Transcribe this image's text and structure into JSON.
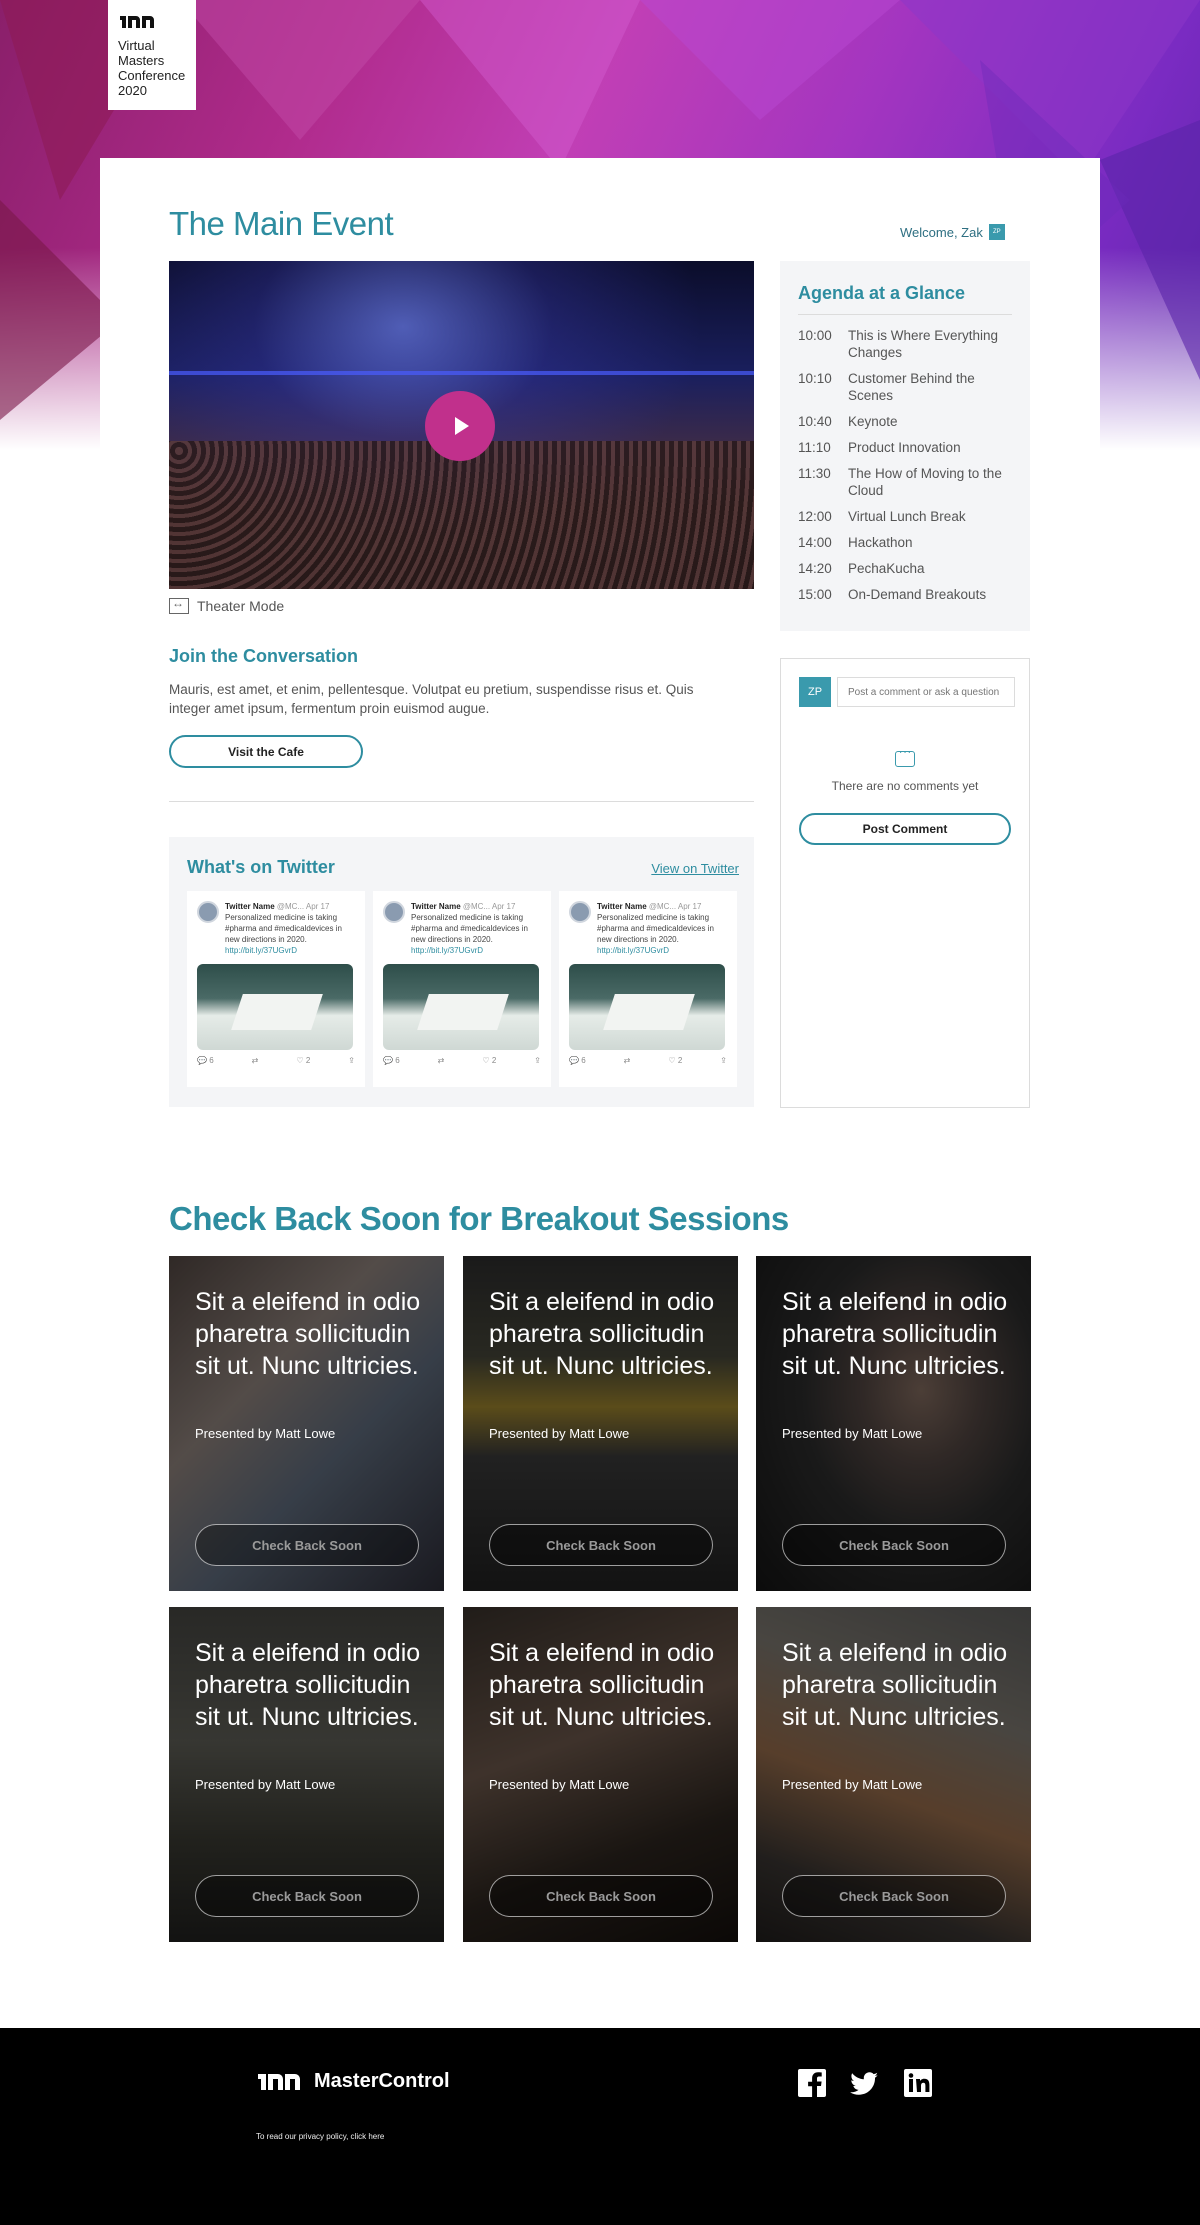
{
  "brand": {
    "logo_lines": [
      "Virtual",
      "Masters",
      "Conference",
      "2020"
    ]
  },
  "header": {
    "title": "The Main Event",
    "welcome": "Welcome, Zak",
    "welcome_badge": "ZP"
  },
  "video": {
    "theater_mode": "Theater Mode"
  },
  "conversation": {
    "title": "Join the Conversation",
    "text": "Mauris, est amet, et enim, pellentesque. Volutpat eu pretium, suspendisse risus et. Quis integer amet ipsum, fermentum proin euismod augue.",
    "button": "Visit the Cafe"
  },
  "twitter": {
    "title": "What's on Twitter",
    "link": "View on Twitter",
    "tweets": [
      {
        "name": "Twitter Name",
        "handle": "@MC... Apr 17",
        "text": "Personalized medicine is taking #pharma and #medicaldevices in new directions in 2020.",
        "link": "http://bit.ly/37UGvrD",
        "replies": "6",
        "likes": "2"
      },
      {
        "name": "Twitter Name",
        "handle": "@MC... Apr 17",
        "text": "Personalized medicine is taking #pharma and #medicaldevices in new directions in 2020.",
        "link": "http://bit.ly/37UGvrD",
        "replies": "6",
        "likes": "2"
      },
      {
        "name": "Twitter Name",
        "handle": "@MC... Apr 17",
        "text": "Personalized medicine is taking #pharma and #medicaldevices in new directions in 2020.",
        "link": "http://bit.ly/37UGvrD",
        "replies": "6",
        "likes": "2"
      }
    ]
  },
  "agenda": {
    "title": "Agenda at a Glance",
    "items": [
      {
        "time": "10:00",
        "label": "This is Where Everything Changes"
      },
      {
        "time": "10:10",
        "label": "Customer Behind the Scenes"
      },
      {
        "time": "10:40",
        "label": "Keynote"
      },
      {
        "time": "11:10",
        "label": "Product Innovation"
      },
      {
        "time": "11:30",
        "label": "The How of Moving to the Cloud"
      },
      {
        "time": "12:00",
        "label": "Virtual Lunch Break"
      },
      {
        "time": "14:00",
        "label": "Hackathon"
      },
      {
        "time": "14:20",
        "label": "PechaKucha"
      },
      {
        "time": "15:00",
        "label": "On-Demand Breakouts"
      }
    ]
  },
  "comments": {
    "avatar": "ZP",
    "placeholder": "Post a comment or ask a question",
    "empty": "There are no comments yet",
    "button": "Post Comment"
  },
  "breakouts": {
    "title": "Check Back Soon for Breakout Sessions",
    "sessions": [
      {
        "title": "Sit a eleifend in odio pharetra sollicitudin sit ut. Nunc ultricies.",
        "presenter": "Presented by Matt Lowe",
        "button": "Check Back Soon"
      },
      {
        "title": "Sit a eleifend in odio pharetra sollicitudin sit ut. Nunc ultricies.",
        "presenter": "Presented by Matt Lowe",
        "button": "Check Back Soon"
      },
      {
        "title": "Sit a eleifend in odio pharetra sollicitudin sit ut. Nunc ultricies.",
        "presenter": "Presented by Matt Lowe",
        "button": "Check Back Soon"
      },
      {
        "title": "Sit a eleifend in odio pharetra sollicitudin sit ut. Nunc ultricies.",
        "presenter": "Presented by Matt Lowe",
        "button": "Check Back Soon"
      },
      {
        "title": "Sit a eleifend in odio pharetra sollicitudin sit ut. Nunc ultricies.",
        "presenter": "Presented by Matt Lowe",
        "button": "Check Back Soon"
      },
      {
        "title": "Sit a eleifend in odio pharetra sollicitudin sit ut. Nunc ultricies.",
        "presenter": "Presented by Matt Lowe",
        "button": "Check Back Soon"
      }
    ]
  },
  "footer": {
    "brand": "MasterControl",
    "privacy": "To read our privacy policy, click here",
    "social": [
      "facebook-icon",
      "twitter-icon",
      "linkedin-icon"
    ]
  },
  "colors": {
    "accent": "#2e8da0",
    "play": "#c1308c",
    "footer": "#000000"
  }
}
